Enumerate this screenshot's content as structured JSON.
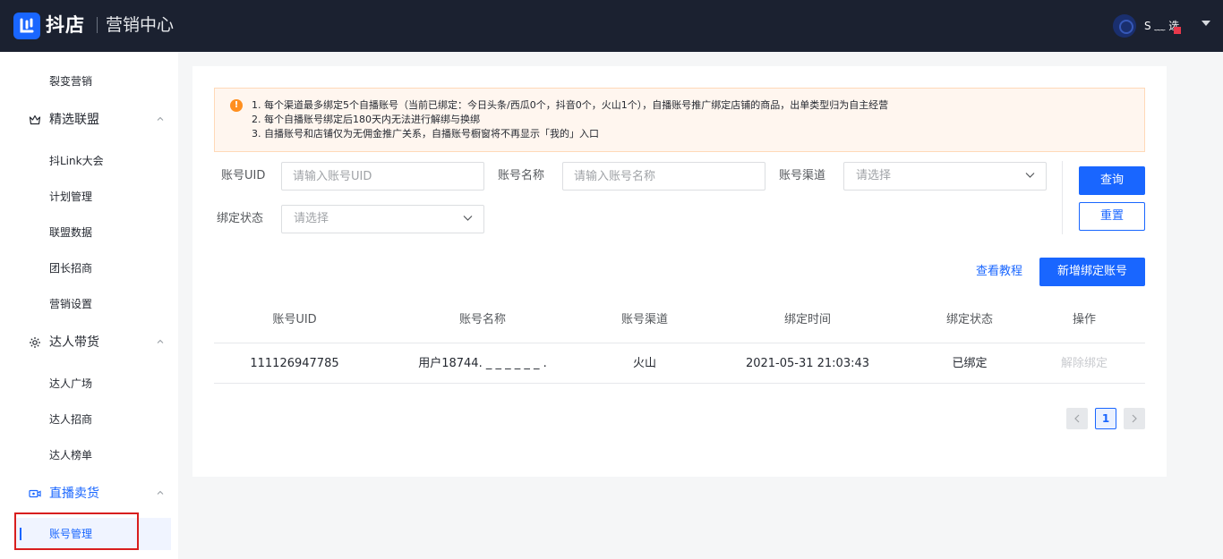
{
  "header": {
    "brand": "抖店",
    "subtitle": "营销中心",
    "user_name": "S  ﹏ 选"
  },
  "sidebar": {
    "items": [
      {
        "label": "裂变营销"
      },
      {
        "group": "精选联盟"
      },
      {
        "label": "抖Link大会"
      },
      {
        "label": "计划管理"
      },
      {
        "label": "联盟数据"
      },
      {
        "label": "团长招商"
      },
      {
        "label": "营销设置"
      },
      {
        "group": "达人带货"
      },
      {
        "label": "达人广场"
      },
      {
        "label": "达人招商"
      },
      {
        "label": "达人榜单"
      },
      {
        "group": "直播卖货"
      },
      {
        "label": "账号管理",
        "active": true
      }
    ]
  },
  "notice": {
    "lines": [
      "1. 每个渠道最多绑定5个自播账号（当前已绑定：今日头条/西瓜0个，抖音0个，火山1个），自播账号推广绑定店铺的商品，出单类型归为自主经营",
      "2. 每个自播账号绑定后180天内无法进行解绑与换绑",
      "3. 自播账号和店铺仅为无佣金推广关系，自播账号橱窗将不再显示「我的」入口"
    ]
  },
  "filters": {
    "uid_label": "账号UID",
    "uid_placeholder": "请输入账号UID",
    "name_label": "账号名称",
    "name_placeholder": "请输入账号名称",
    "channel_label": "账号渠道",
    "channel_placeholder": "请选择",
    "status_label": "绑定状态",
    "status_placeholder": "请选择",
    "query_button": "查询",
    "reset_button": "重置"
  },
  "actions": {
    "tutorial_link": "查看教程",
    "add_button": "新增绑定账号"
  },
  "table": {
    "columns": [
      "账号UID",
      "账号名称",
      "账号渠道",
      "绑定时间",
      "绑定状态",
      "操作"
    ],
    "rows": [
      {
        "uid": "111126947785",
        "name": "用户18744. _ _ _ _ _ _ .",
        "channel": "火山",
        "time": "2021-05-31 21:03:43",
        "status": "已绑定",
        "action": "解除绑定"
      }
    ]
  },
  "pagination": {
    "current": "1"
  },
  "colors": {
    "accent": "#1966ff",
    "topbar": "#1b2130",
    "warning": "#ff8f1f",
    "highlight_frame": "#d81e1e"
  }
}
